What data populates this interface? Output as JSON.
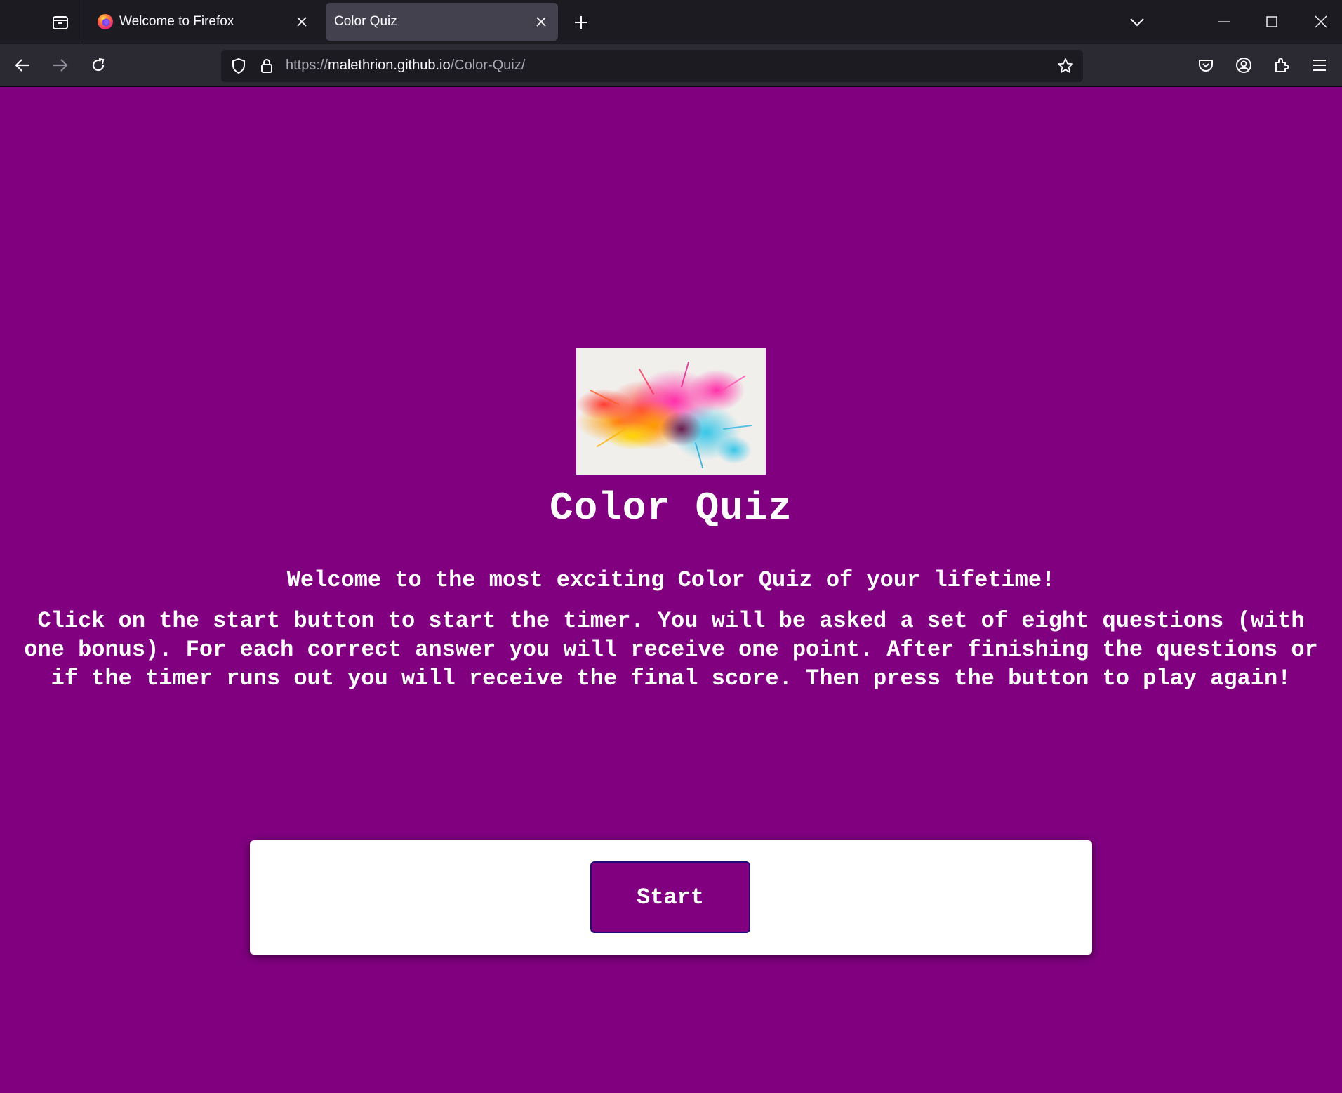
{
  "browser": {
    "tabs": [
      {
        "label": "Welcome to Firefox",
        "active": false,
        "icon": "firefox-icon"
      },
      {
        "label": "Color Quiz",
        "active": true,
        "icon": null
      }
    ],
    "url": {
      "scheme": "https://",
      "host": "malethrion.github.io",
      "path": "/Color-Quiz/"
    }
  },
  "page": {
    "background_color": "#800080",
    "title": "Color Quiz",
    "welcome": "Welcome to the most exciting Color Quiz of your lifetime!",
    "instructions": "Click on the start button to start the timer. You will be asked a set of eight questions (with one bonus). For each correct answer you will receive one point. After finishing the questions or if the timer runs out you will receive the final score. Then press the button to play again!",
    "start_button": "Start"
  }
}
